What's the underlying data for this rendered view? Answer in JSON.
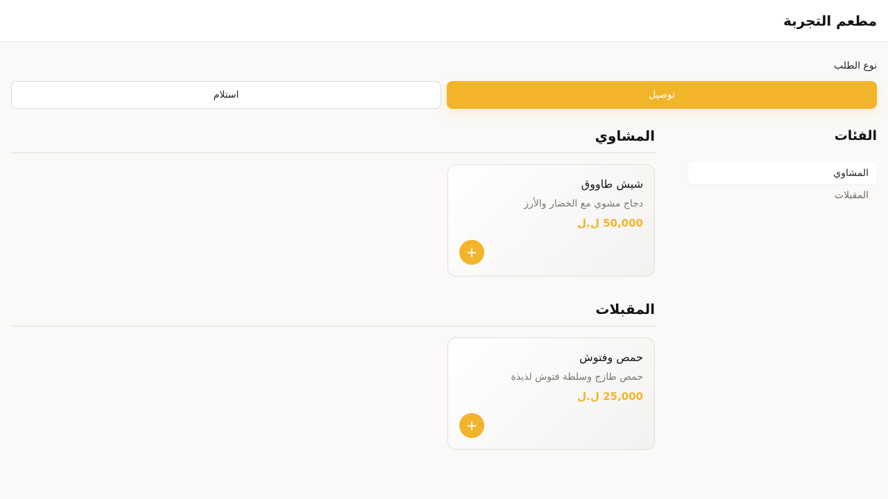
{
  "header": {
    "title": "مطعم التجربة"
  },
  "order_type": {
    "label": "نوع الطلب",
    "options": [
      {
        "label": "توصيل",
        "active": true
      },
      {
        "label": "استلام",
        "active": false
      }
    ]
  },
  "sidebar": {
    "title": "الفئات",
    "categories": [
      {
        "label": "المشاوي",
        "active": true
      },
      {
        "label": "المقبلات",
        "active": false
      }
    ]
  },
  "menu": {
    "sections": [
      {
        "title": "المشاوي",
        "items": [
          {
            "name": "شيش طاووق",
            "description": "دجاج مشوي مع الخضار والأرز",
            "price": "50,000 ل.ل",
            "add_icon": "+"
          }
        ]
      },
      {
        "title": "المقبلات",
        "items": [
          {
            "name": "حمص وفتوش",
            "description": "حمص طازج وسلطة فتوش لذيذة",
            "price": "25,000 ل.ل",
            "add_icon": "+"
          }
        ]
      }
    ]
  },
  "colors": {
    "accent": "#f2b42a",
    "background": "#faf9f7"
  }
}
